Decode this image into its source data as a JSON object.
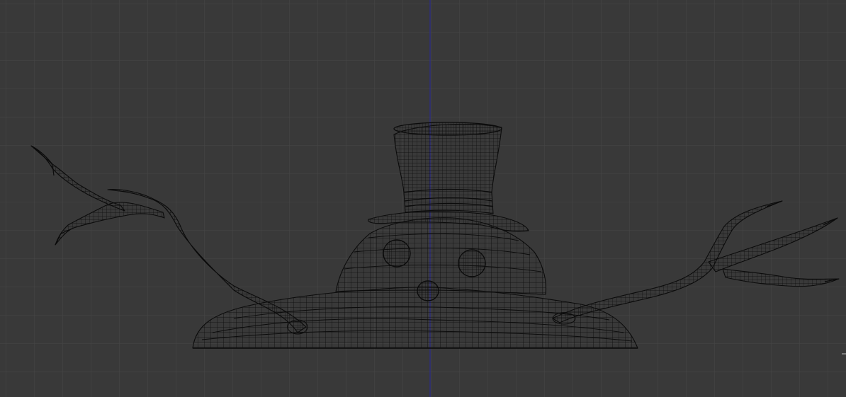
{
  "viewport": {
    "background_color": "#393939",
    "grid_color": "#464646",
    "axis_color": "#2c2c8a",
    "wire_color": "#0b0b0b"
  },
  "mesh": {
    "name_icon": "snowman-wireframe-mesh",
    "parts": [
      "top-hat",
      "head",
      "button-eye-left",
      "button-eye-right",
      "button-nose",
      "melted-body-base",
      "left-branch-arm",
      "right-branch-arm"
    ]
  }
}
